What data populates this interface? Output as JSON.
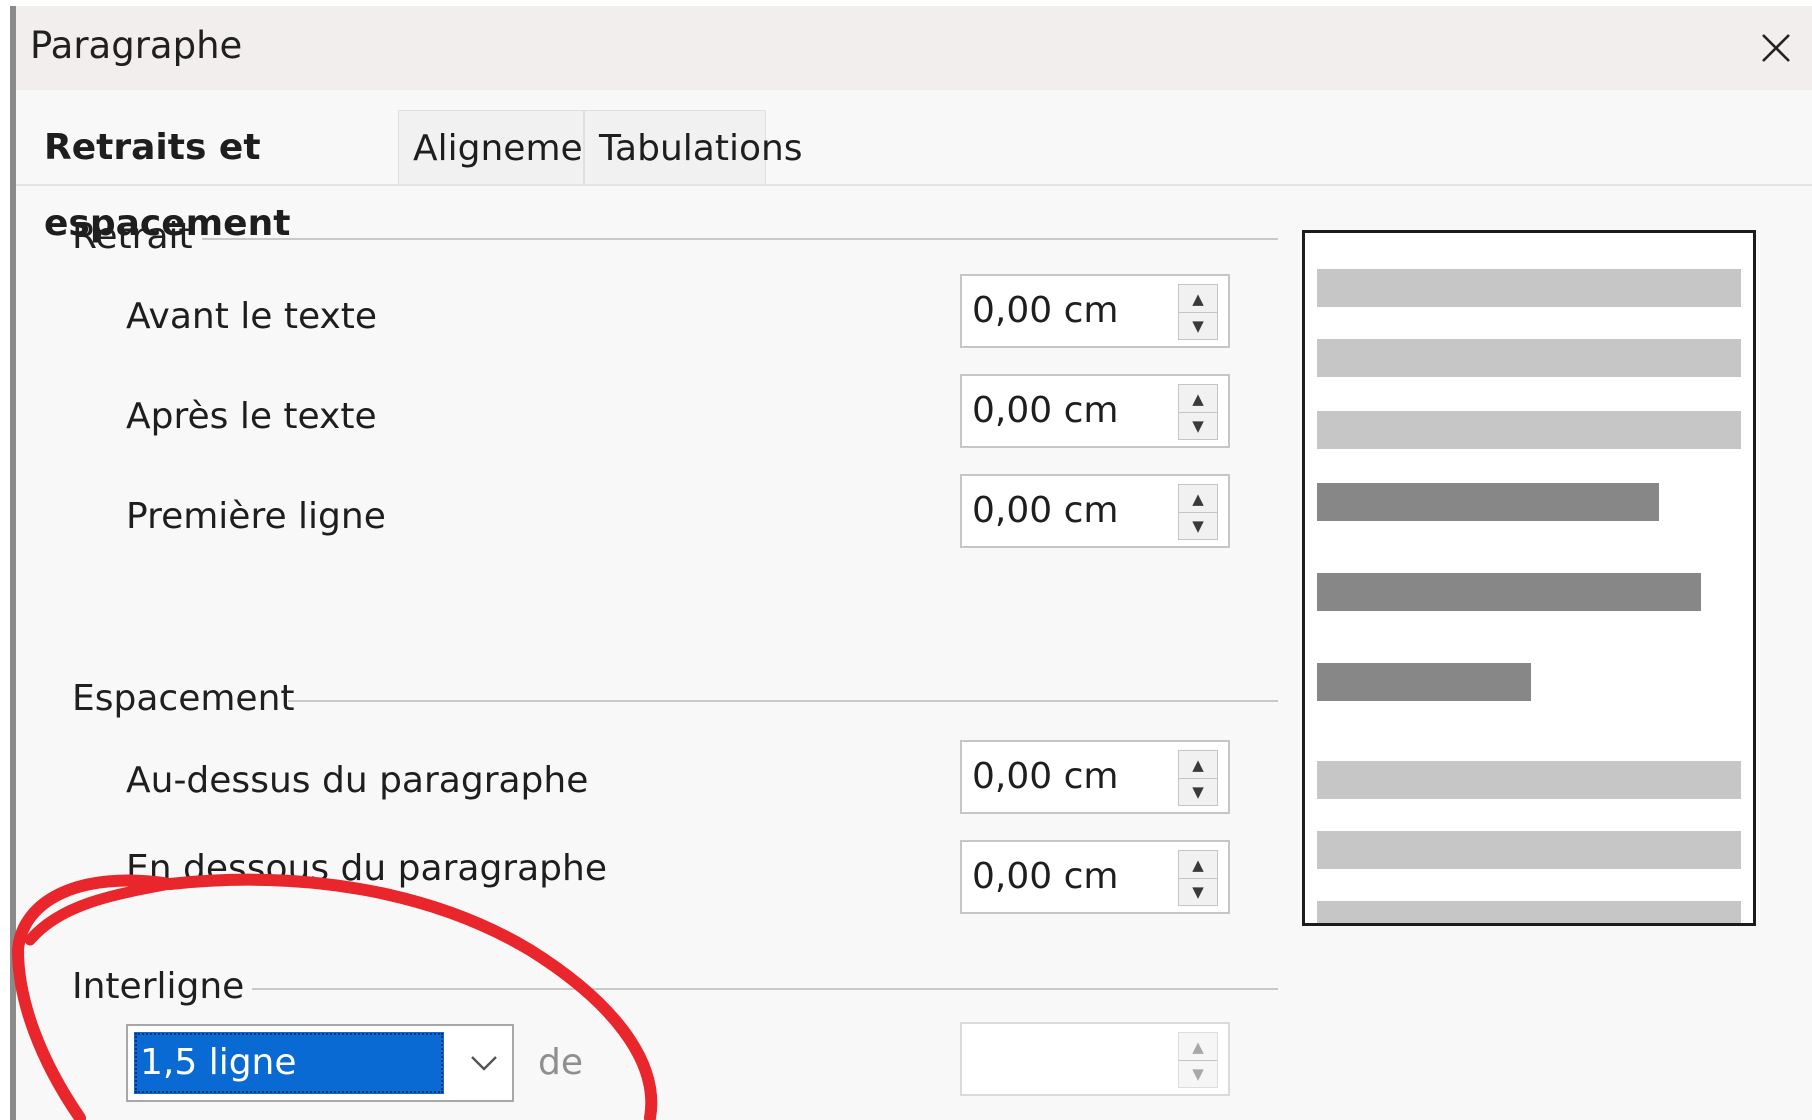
{
  "dialog": {
    "title": "Paragraphe"
  },
  "tabs": [
    {
      "label": "Retraits et espacement",
      "active": true
    },
    {
      "label": "Alignement",
      "active": false
    },
    {
      "label": "Tabulations",
      "active": false
    }
  ],
  "indent": {
    "section_label": "Retrait",
    "before_text": {
      "label": "Avant le texte",
      "value": "0,00 cm"
    },
    "after_text": {
      "label": "Après le texte",
      "value": "0,00 cm"
    },
    "first_line": {
      "label": "Première ligne",
      "value": "0,00 cm"
    }
  },
  "spacing": {
    "section_label": "Espacement",
    "above": {
      "label": "Au-dessus du paragraphe",
      "value": "0,00 cm"
    },
    "below": {
      "label": "En dessous du paragraphe",
      "value": "0,00 cm"
    }
  },
  "line_spacing": {
    "section_label": "Interligne",
    "selected": "1,5 ligne",
    "of_label": "de",
    "value": ""
  },
  "colors": {
    "selection": "#0a6ad4",
    "annotation": "#e8262b",
    "preview_light": "#c6c6c6",
    "preview_dark": "#878787"
  },
  "icons": {
    "close": "close-icon",
    "spin_up": "spin-up-icon",
    "spin_down": "spin-down-icon",
    "dropdown": "chevron-down-icon"
  }
}
